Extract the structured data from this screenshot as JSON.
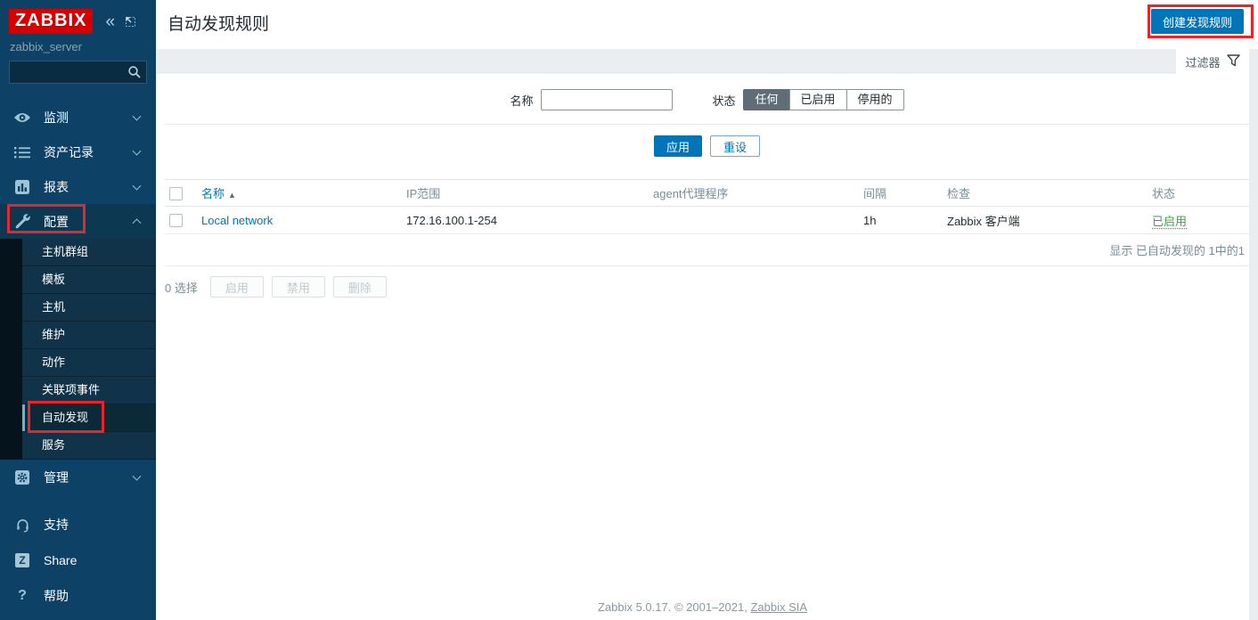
{
  "colors": {
    "accent_blue": "#0275b8",
    "logo_red": "#d40000",
    "annotation_red": "#e8252a",
    "status_enabled_green": "#429e47",
    "sidebar_bg": "#0d4166"
  },
  "sidebar": {
    "logo_text": "ZABBIX",
    "server_name": "zabbix_server",
    "collapse_glyph": "«",
    "search_placeholder": "",
    "menu": [
      {
        "label": "监测",
        "icon": "eye-icon"
      },
      {
        "label": "资产记录",
        "icon": "list-icon"
      },
      {
        "label": "报表",
        "icon": "bar-chart-icon"
      },
      {
        "label": "配置",
        "icon": "wrench-icon"
      },
      {
        "label": "管理",
        "icon": "gear-icon"
      }
    ],
    "config_submenu": [
      "主机群组",
      "模板",
      "主机",
      "维护",
      "动作",
      "关联项事件",
      "自动发现",
      "服务"
    ],
    "selected_submenu": "自动发现",
    "bottom_menu": [
      {
        "label": "支持",
        "icon": "headset-icon"
      },
      {
        "label": "Share",
        "icon": "share-z-icon"
      },
      {
        "label": "帮助",
        "icon": "question-icon"
      }
    ]
  },
  "header": {
    "title": "自动发现规则",
    "create_button": "创建发现规则"
  },
  "filter": {
    "tab_label": "过滤器",
    "name_label": "名称",
    "name_value": "",
    "status_label": "状态",
    "status_options": [
      "任何",
      "已启用",
      "停用的"
    ],
    "status_selected": "任何",
    "apply_button": "应用",
    "reset_button": "重设"
  },
  "table": {
    "headers": {
      "name": "名称",
      "ip_range": "IP范围",
      "proxy": "agent代理程序",
      "interval": "间隔",
      "checks": "检查",
      "status": "状态"
    },
    "sort_icon": "▲",
    "rows": [
      {
        "name": "Local network",
        "ip_range": "172.16.100.1-254",
        "proxy": "",
        "interval": "1h",
        "checks": "Zabbix 客户端",
        "status": "已启用"
      }
    ],
    "display_info": "显示 已自动发现的 1中的1"
  },
  "selection": {
    "count_label": "0 选择",
    "enable_button": "启用",
    "disable_button": "禁用",
    "delete_button": "删除"
  },
  "footer": {
    "text_before": "Zabbix 5.0.17. © 2001–2021, ",
    "link": "Zabbix SIA"
  }
}
